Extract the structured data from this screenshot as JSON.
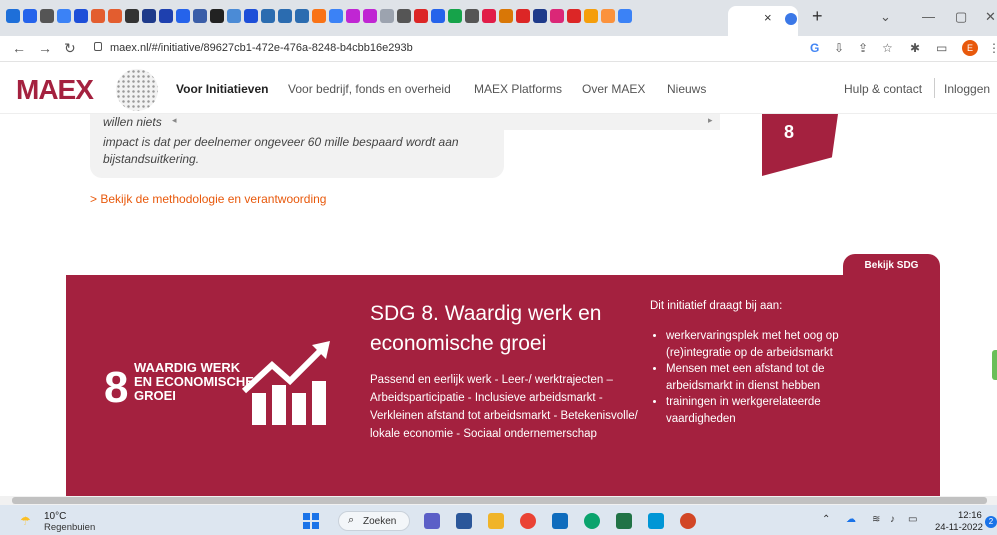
{
  "browser": {
    "tab_colors": [
      "#1e6fd9",
      "#2563eb",
      "#555",
      "#3b82f6",
      "#1d4ed8",
      "#e35d2f",
      "#e35d2f",
      "#333",
      "#1e3a8a",
      "#1e40af",
      "#2563eb",
      "#3b5ea8",
      "#222",
      "#4b8bd6",
      "#1d4ed8",
      "#2b6cb0",
      "#2b6cb0",
      "#2b6cb0",
      "#f97316",
      "#3b82f6",
      "#c026d3",
      "#c026d3",
      "#9ca3af",
      "#555",
      "#dc2626",
      "#2563eb",
      "#16a34a",
      "#555",
      "#e11d48",
      "#d97706",
      "#dc2626",
      "#1e3a8a",
      "#db2777",
      "#dc2626",
      "#f59e0b",
      "#fb923c",
      "#3b82f6"
    ],
    "active_tab_close": "×",
    "new_tab": "+",
    "url": "maex.nl/#/initiative/89627cb1-472e-476a-8248-b4cbb16e293b",
    "profile_initial": "E"
  },
  "nav": {
    "logo": "MAEX",
    "links": [
      "Voor Initiatieven",
      "Voor bedrijf, fonds en overheid",
      "MAEX Platforms",
      "Over MAEX",
      "Nieuws"
    ],
    "help": "Hulp & contact",
    "login": "Inloggen"
  },
  "content": {
    "quote_lines": [
      "willen niets",
      "impact is dat per deelnemer ongeveer 60 mille bespaard wordt aan",
      "bijstandsuitkering."
    ],
    "wedge_number": "8",
    "method_link": "> Bekijk de methodologie en verantwoording",
    "sdg_tab": "Bekijk SDG",
    "sdg_icon_number": "8",
    "sdg_icon_label": "WAARDIG WERK EN ECONOMISCHE GROEI",
    "sdg_title": "SDG 8. Waardig werk en economische groei",
    "sdg_description": "Passend en eerlijk werk - Leer-/ werktrajecten – Arbeidsparticipatie - Inclusieve arbeidsmarkt - Verkleinen afstand tot arbeidsmarkt - Betekenisvolle/ lokale economie - Sociaal ondernemerschap",
    "contrib_head": "Dit initiatief draagt bij aan:",
    "contrib_items": [
      "werkervaringsplek met het oog op (re)integratie op de arbeidsmarkt",
      "Mensen met een afstand tot de arbeidsmarkt in dienst hebben",
      "trainingen in werkgerelateerde vaardigheden"
    ]
  },
  "taskbar": {
    "temp": "10°C",
    "weather": "Regenbuien",
    "search": "Zoeken",
    "time": "12:16",
    "date": "24-11-2022",
    "notif_count": "2"
  },
  "colors": {
    "brand": "#a4213f",
    "link": "#e8590c"
  }
}
